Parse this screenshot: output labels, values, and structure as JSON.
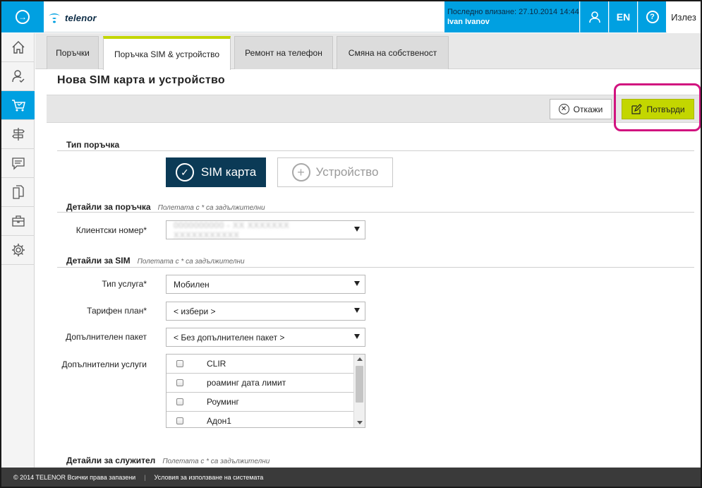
{
  "header": {
    "brand": "telenor",
    "last_login": "Последно влизане: 27.10.2014 14:44",
    "user_name": "Ivan Ivanov",
    "lang_label": "EN",
    "help_label": "?",
    "logout_label": "Излез",
    "icons": {
      "nav": "arrow-right-circle-icon",
      "user": "user-icon",
      "help": "question-icon"
    }
  },
  "sidebar": {
    "items": [
      {
        "icon": "home-icon",
        "active": false
      },
      {
        "icon": "user-check-icon",
        "active": false
      },
      {
        "icon": "cart-icon",
        "active": true
      },
      {
        "icon": "signpost-icon",
        "active": false
      },
      {
        "icon": "chat-icon",
        "active": false
      },
      {
        "icon": "documents-icon",
        "active": false
      },
      {
        "icon": "briefcase-icon",
        "active": false
      },
      {
        "icon": "gear-icon",
        "active": false
      }
    ]
  },
  "tabs": [
    {
      "label": "Поръчки",
      "active": false
    },
    {
      "label": "Поръчка SIM & устройство",
      "active": true
    },
    {
      "label": "Ремонт на телефон",
      "active": false
    },
    {
      "label": "Смяна на собственост",
      "active": false
    }
  ],
  "page": {
    "title": "Нова SIM карта и устройство",
    "cancel_label": "Откажи",
    "confirm_label": "Потвърди"
  },
  "order_type": {
    "title": "Тип поръчка",
    "sim_label": "SIM карта",
    "device_label": "Устройство",
    "selected": "SIM карта"
  },
  "order_details": {
    "title": "Детайли за поръчка",
    "hint": "Полетата с * са задължителни",
    "client_label": "Клиентски номер*",
    "client_value": "0000000000 - XX XXXXXXX XXXXXXXXXXX"
  },
  "sim_details": {
    "title": "Детайли за SIM",
    "hint": "Полетата с * са задължителни",
    "service_label": "Тип услуга*",
    "service_value": "Мобилен",
    "plan_label": "Тарифен план*",
    "plan_value": "< избери >",
    "package_label": "Допълнителен пакет",
    "package_value": "< Без допълнителен пакет >",
    "services_label": "Допълнителни услуги",
    "services": [
      "CLIR",
      "роаминг дата лимит",
      "Роуминг",
      "Адон1"
    ]
  },
  "employee_details": {
    "title": "Детайли за служител",
    "hint": "Полетата с * са задължителни"
  },
  "footer": {
    "copyright": "© 2014 TELENOR Всички права запазени",
    "terms": "Условия за използване на системата"
  },
  "colors": {
    "accent_blue": "#00a0e1",
    "lime": "#c3d600",
    "navy": "#0b3a56",
    "highlight": "#d1137f"
  }
}
